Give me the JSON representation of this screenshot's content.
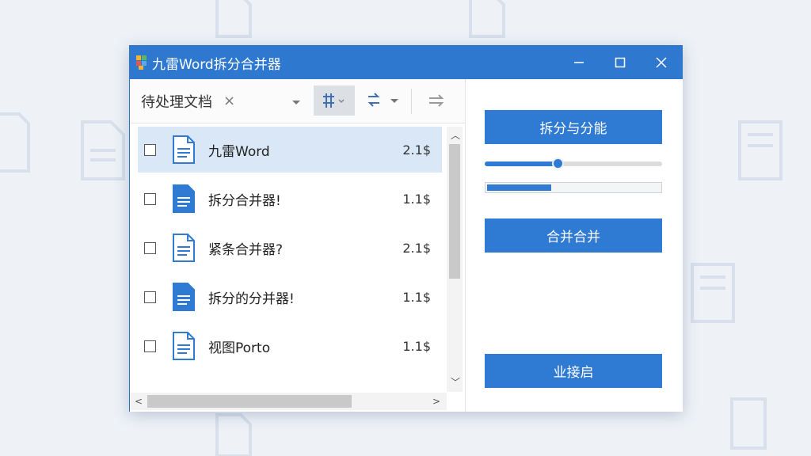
{
  "window": {
    "title": "九雷Word拆分合并器",
    "controls": {
      "minimize_icon": "minimize-icon",
      "maximize_icon": "maximize-icon",
      "close_icon": "close-icon"
    }
  },
  "toolbar": {
    "tab_label": "待处理文档",
    "tab_close": "×"
  },
  "files": [
    {
      "name": "九雷Word",
      "size": "2.1$",
      "checked": false,
      "selected": true
    },
    {
      "name": "拆分合并器!",
      "size": "1.1$",
      "checked": false,
      "selected": false
    },
    {
      "name": "紧条合并器?",
      "size": "2.1$",
      "checked": false,
      "selected": false
    },
    {
      "name": "拆分的分并器!",
      "size": "1.1$",
      "checked": false,
      "selected": false
    },
    {
      "name": "视图Porto",
      "size": "1.1$",
      "checked": false,
      "selected": false
    }
  ],
  "actions": {
    "split_label": "拆分与分能",
    "merge_label": "合并合并",
    "start_label": "业接启"
  },
  "slider": {
    "value": 0.41
  },
  "progress": {
    "value": 0.37
  },
  "colors": {
    "accent": "#2f7ad2",
    "titlebar": "#2f78cf",
    "selected_row": "#d9e7f7"
  }
}
